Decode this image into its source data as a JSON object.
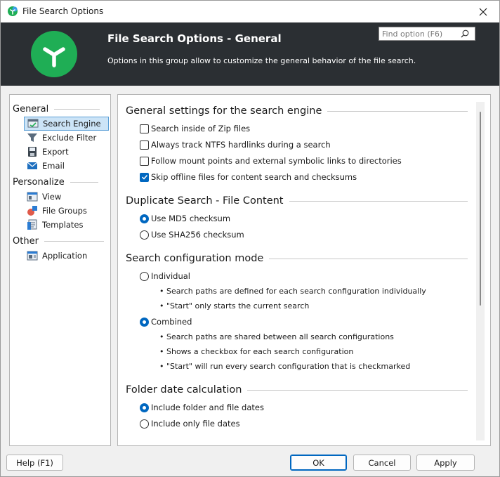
{
  "window": {
    "title": "File Search Options"
  },
  "header": {
    "title": "File Search Options - General",
    "description": "Options in this group allow to customize the general behavior of the file search.",
    "search_placeholder": "Find option (F6)"
  },
  "nav": {
    "groups": [
      {
        "label": "General",
        "items": [
          {
            "label": "Search Engine",
            "icon": "search-engine-icon",
            "selected": true
          },
          {
            "label": "Exclude Filter",
            "icon": "exclude-filter-icon"
          },
          {
            "label": "Export",
            "icon": "export-icon"
          },
          {
            "label": "Email",
            "icon": "email-icon"
          }
        ]
      },
      {
        "label": "Personalize",
        "items": [
          {
            "label": "View",
            "icon": "view-icon"
          },
          {
            "label": "File Groups",
            "icon": "file-groups-icon"
          },
          {
            "label": "Templates",
            "icon": "templates-icon"
          }
        ]
      },
      {
        "label": "Other",
        "items": [
          {
            "label": "Application",
            "icon": "application-icon"
          }
        ]
      }
    ]
  },
  "sections": {
    "general": {
      "title": "General settings for the search engine",
      "options": [
        {
          "label": "Search inside of Zip files",
          "checked": false
        },
        {
          "label": "Always track NTFS hardlinks during a search",
          "checked": false
        },
        {
          "label": "Follow mount points and external symbolic links to directories",
          "checked": false
        },
        {
          "label": "Skip offline files for content search and checksums",
          "checked": true
        }
      ]
    },
    "duplicate": {
      "title": "Duplicate Search - File Content",
      "options": [
        {
          "label": "Use MD5 checksum",
          "checked": true
        },
        {
          "label": "Use SHA256 checksum",
          "checked": false
        }
      ]
    },
    "config_mode": {
      "title": "Search configuration mode",
      "individual": {
        "label": "Individual",
        "checked": false,
        "bullets": [
          "• Search paths are defined for each search configuration individually",
          "• \"Start\" only starts the current search"
        ]
      },
      "combined": {
        "label": "Combined",
        "checked": true,
        "bullets": [
          "• Search paths are shared between all search configurations",
          "• Shows a checkbox for each search configuration",
          "• \"Start\" will run every search configuration that is checkmarked"
        ]
      }
    },
    "folder_date": {
      "title": "Folder date calculation",
      "options": [
        {
          "label": "Include folder and file dates",
          "checked": true
        },
        {
          "label": "Include only file dates",
          "checked": false
        }
      ]
    }
  },
  "buttons": {
    "help": "Help (F1)",
    "ok": "OK",
    "cancel": "Cancel",
    "apply": "Apply"
  },
  "colors": {
    "banner": "#2b2f33",
    "logo": "#1fae55",
    "accent": "#0067c0",
    "selection": "#cce4f7"
  }
}
